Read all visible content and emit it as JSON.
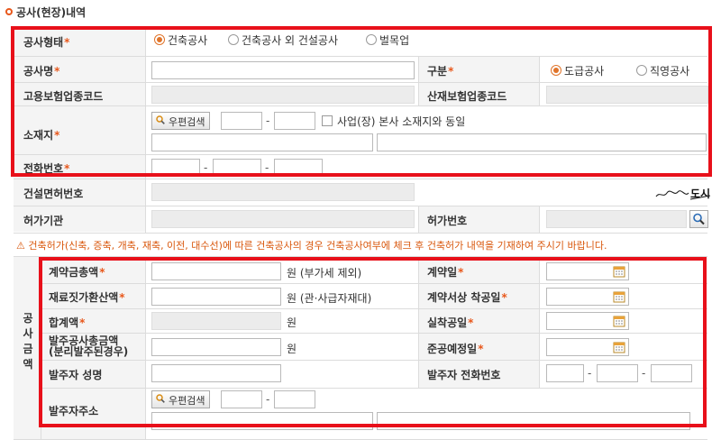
{
  "section_title": "공사(현장)내역",
  "required_mark": "*",
  "type_row": {
    "label": "공사형태",
    "options": [
      "건축공사",
      "건축공사 외 건설공사",
      "벌목업"
    ],
    "selected": "건축공사"
  },
  "name_row": {
    "label": "공사명",
    "division_label": "구분",
    "division_options": [
      "도급공사",
      "직영공사"
    ],
    "division_selected": "도급공사"
  },
  "codes_row": {
    "employment_label": "고용보험업종코드",
    "industrial_label": "산재보험업종코드"
  },
  "location_row": {
    "label": "소재지",
    "zip_button": "우편검색",
    "same_as_hq_label": "사업(장) 본사 소재지와 동일"
  },
  "phone_row": {
    "label": "전화번호"
  },
  "license_row": {
    "label": "건설면허번호",
    "signature": "도시건설"
  },
  "permit_row": {
    "agency_label": "허가기관",
    "number_label": "허가번호"
  },
  "warning": "⚠ 건축허가(신축, 증축, 개축, 재축, 이전, 대수선)에 따른 건축공사의 경우 건축공사여부에 체크 후 건축허가 내역을 기재하여 주시기 바랍니다.",
  "amount_section": {
    "side_label": [
      "공",
      "사",
      "금",
      "액"
    ],
    "contract_total_label": "계약금총액",
    "contract_total_unit": "원 (부가세 제외)",
    "contract_date_label": "계약일",
    "material_label": "재료짓가환산액",
    "material_unit": "원 (관·사급자재대)",
    "start_date_label": "계약서상 착공일",
    "sum_label": "합계액",
    "sum_unit": "원",
    "actual_start_label": "실착공일",
    "separate_label_1": "발주공사총금액",
    "separate_label_2": "(분리발주된경우)",
    "separate_unit": "원",
    "completion_label": "준공예정일",
    "client_name_label": "발주자 성명",
    "client_phone_label": "발주자 전화번호",
    "client_address_label": "발주자주소",
    "zip_button": "우편검색"
  }
}
